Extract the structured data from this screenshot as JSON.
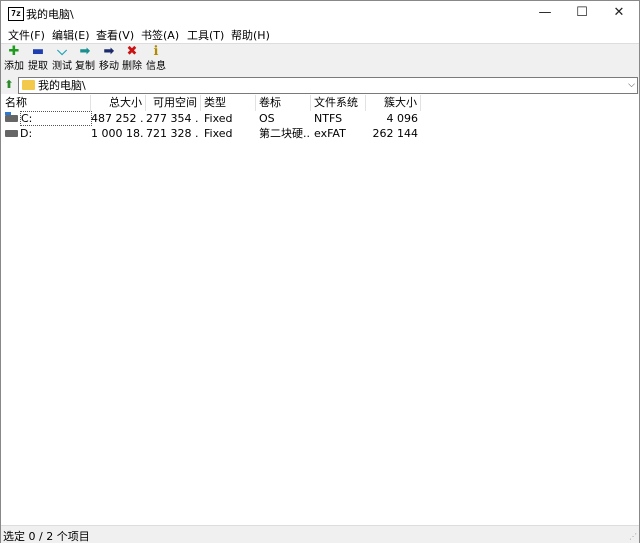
{
  "window": {
    "title": "我的电脑\\",
    "app_icon_text": "7z",
    "controls": {
      "minimize": "—",
      "maximize": "☐",
      "close": "✕"
    }
  },
  "menu": [
    "文件(F)",
    "编辑(E)",
    "查看(V)",
    "书签(A)",
    "工具(T)",
    "帮助(H)"
  ],
  "toolbar": [
    {
      "label": "添加",
      "icon": "add-icon",
      "glyph": "✚",
      "color": "#1e9a1e"
    },
    {
      "label": "提取",
      "icon": "extract-icon",
      "glyph": "▬",
      "color": "#1f3fb0"
    },
    {
      "label": "测试",
      "icon": "test-icon",
      "glyph": "⌵",
      "color": "#1aa3b8"
    },
    {
      "label": "复制",
      "icon": "copy-icon",
      "glyph": "➡",
      "color": "#1a8f8f"
    },
    {
      "label": "移动",
      "icon": "move-icon",
      "glyph": "➡",
      "color": "#1a2a6a"
    },
    {
      "label": "删除",
      "icon": "delete-icon",
      "glyph": "✖",
      "color": "#cc1111"
    },
    {
      "label": "信息",
      "icon": "info-icon",
      "glyph": "ℹ",
      "color": "#b08a00"
    }
  ],
  "address": {
    "path": "我的电脑\\"
  },
  "columns": [
    "名称",
    "总大小",
    "可用空间",
    "类型",
    "卷标",
    "文件系统",
    "簇大小"
  ],
  "rows": [
    {
      "name": "C:",
      "total": "487 252 ...",
      "free": "277 354 ...",
      "type": "Fixed",
      "label": "OS",
      "fs": "NTFS",
      "cluster": "4 096",
      "icon": "system-drive-icon"
    },
    {
      "name": "D:",
      "total": "1 000 18...",
      "free": "721 328 ...",
      "type": "Fixed",
      "label": "第二块硬...",
      "fs": "exFAT",
      "cluster": "262 144",
      "icon": "drive-icon"
    }
  ],
  "status": {
    "text": "选定 0 / 2 个项目"
  }
}
